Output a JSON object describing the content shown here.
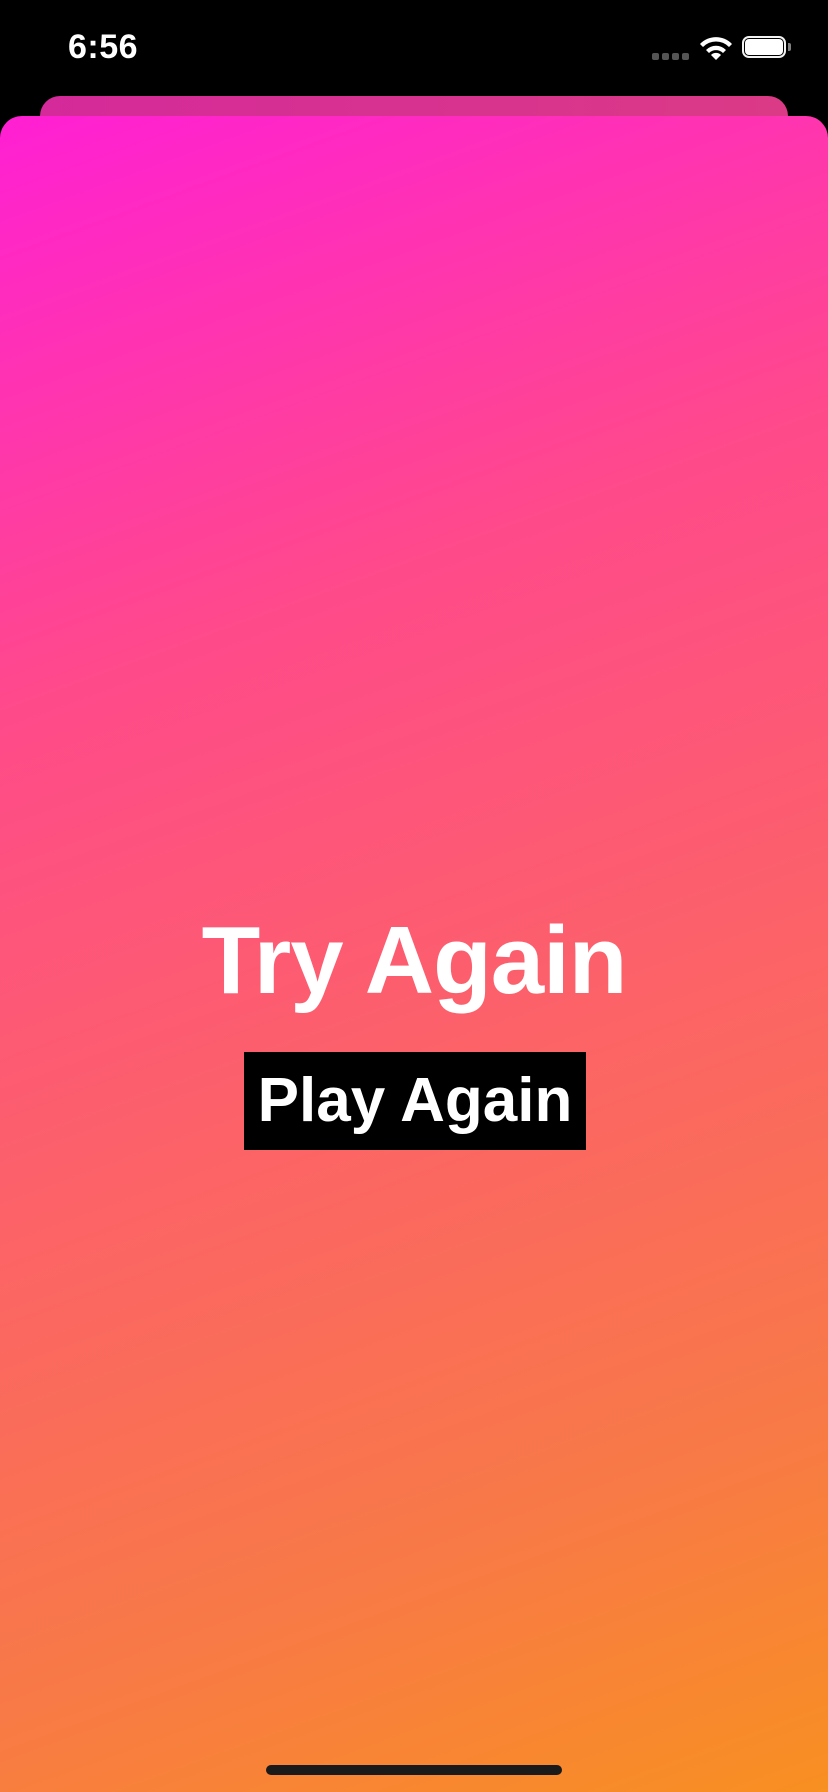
{
  "status_bar": {
    "time": "6:56",
    "icons": [
      "cellular-signal-icon",
      "wifi-icon",
      "battery-icon"
    ]
  },
  "game_over": {
    "title": "Try Again",
    "play_again_label": "Play Again"
  },
  "colors": {
    "gradient_start": "#ff1fd4",
    "gradient_mid": "#fc6268",
    "gradient_end": "#f8911f",
    "button_background": "#000000",
    "text": "#ffffff"
  }
}
